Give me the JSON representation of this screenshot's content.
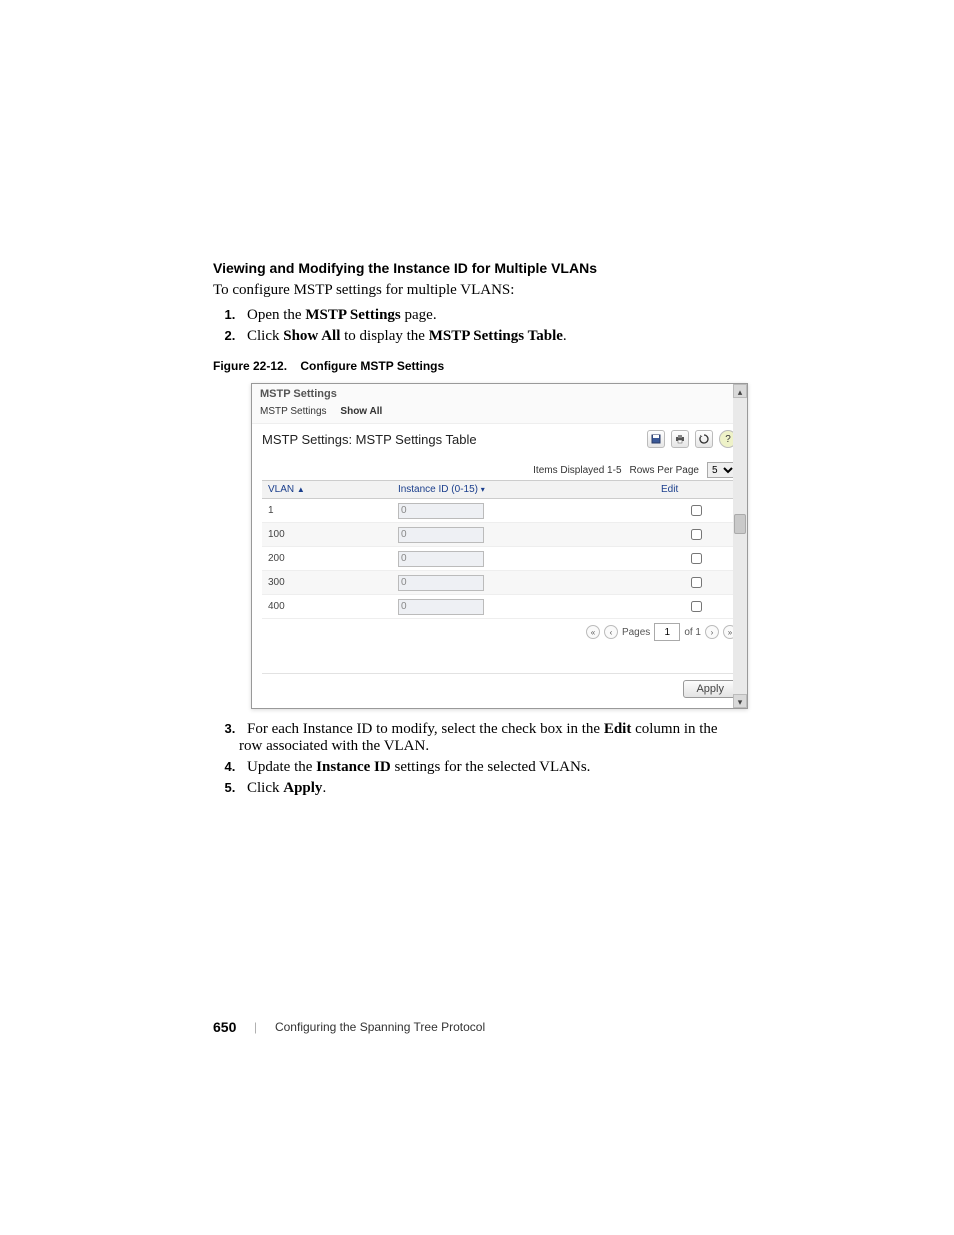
{
  "section_heading": "Viewing and Modifying the Instance ID for Multiple VLANs",
  "intro": "To configure MSTP settings for multiple VLANS:",
  "steps_top": [
    {
      "pre": "Open the ",
      "bold": "MSTP Settings",
      "post": " page."
    },
    {
      "pre": "Click ",
      "bold": "Show All",
      "mid": " to display the ",
      "bold2": "MSTP Settings Table",
      "post": "."
    }
  ],
  "figure_caption": {
    "label": "Figure 22-12.",
    "title": "Configure MSTP Settings"
  },
  "screenshot": {
    "tab_title": "MSTP Settings",
    "breadcrumb": [
      "MSTP Settings",
      "Show All"
    ],
    "panel_title": "MSTP Settings: MSTP Settings Table",
    "toolbar_icons": [
      "save-icon",
      "print-icon",
      "refresh-icon",
      "help-icon"
    ],
    "controls": {
      "items_displayed": "Items Displayed 1-5",
      "rows_per_page_label": "Rows Per Page",
      "rows_per_page_value": "5"
    },
    "table": {
      "headers": [
        "VLAN",
        "Instance ID (0-15)",
        "Edit"
      ],
      "rows": [
        {
          "vlan": "1",
          "instance": "0",
          "edit": false
        },
        {
          "vlan": "100",
          "instance": "0",
          "edit": false
        },
        {
          "vlan": "200",
          "instance": "0",
          "edit": false
        },
        {
          "vlan": "300",
          "instance": "0",
          "edit": false
        },
        {
          "vlan": "400",
          "instance": "0",
          "edit": false
        }
      ]
    },
    "paginator": {
      "pages_label": "Pages",
      "page_value": "1",
      "of_label": "of 1"
    },
    "apply_label": "Apply"
  },
  "steps_bottom": [
    {
      "pre": "For each Instance ID to modify, select the check box in the ",
      "bold": "Edit",
      "post": " column in the row associated with the VLAN."
    },
    {
      "pre": "Update the ",
      "bold": "Instance ID",
      "post": " settings for the selected VLANs."
    },
    {
      "pre": "Click ",
      "bold": "Apply",
      "post": "."
    }
  ],
  "footer": {
    "page_number": "650",
    "chapter": "Configuring the Spanning Tree Protocol"
  }
}
